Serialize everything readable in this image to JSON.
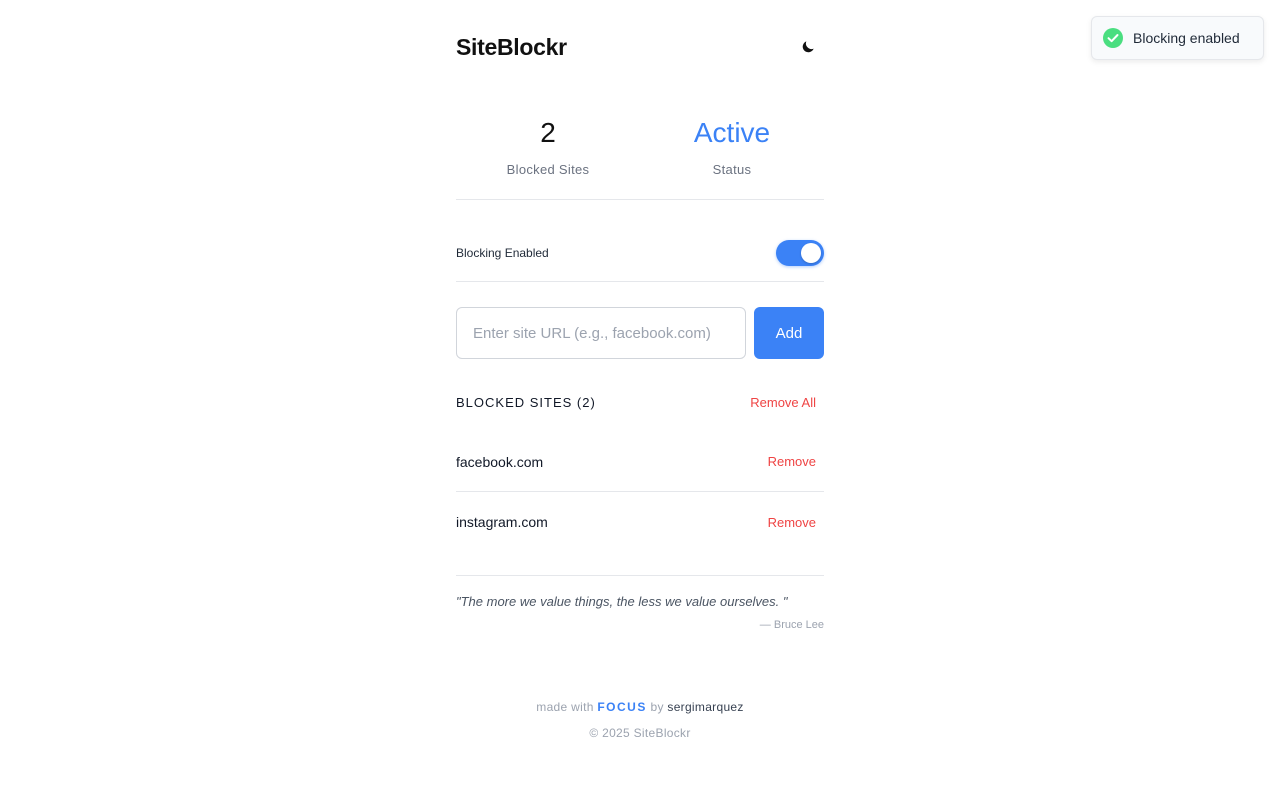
{
  "header": {
    "title": "SiteBlockr",
    "theme_icon": "moon-icon"
  },
  "stats": {
    "blocked_count": "2",
    "blocked_label": "Blocked Sites",
    "status_value": "Active",
    "status_label": "Status",
    "status_color": "#3b82f6"
  },
  "toggle": {
    "label": "Blocking Enabled",
    "enabled": true
  },
  "add_form": {
    "placeholder": "Enter site URL (e.g., facebook.com)",
    "value": "",
    "button_label": "Add"
  },
  "list": {
    "title": "BLOCKED SITES (2)",
    "remove_all_label": "Remove All",
    "items": [
      {
        "site": "facebook.com",
        "remove_label": "Remove"
      },
      {
        "site": "instagram.com",
        "remove_label": "Remove"
      }
    ]
  },
  "quote": {
    "text": "\"The more we value things, the less we value ourselves. \"",
    "author": "— Bruce Lee"
  },
  "footer": {
    "made_with": "made with",
    "brand": "FOCUS",
    "by": "by",
    "author": "sergimarquez",
    "copyright": "© 2025 SiteBlockr"
  },
  "toast": {
    "message": "Blocking enabled",
    "icon": "check-circle-icon",
    "icon_color": "#4ade80"
  },
  "colors": {
    "accent": "#3b82f6",
    "danger": "#ef4444"
  }
}
